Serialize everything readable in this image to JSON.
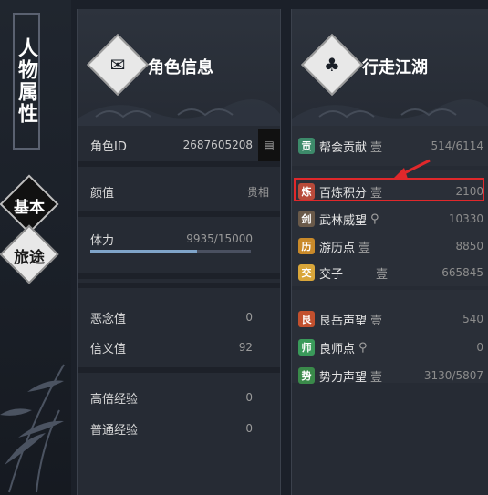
{
  "left_panel": {
    "title": "人物属性",
    "tabs": [
      {
        "label": "基本",
        "active": false
      },
      {
        "label": "旅途",
        "active": true
      }
    ]
  },
  "character_info": {
    "title": "角色信息",
    "role_id_label": "角色ID",
    "role_id_value": "2687605208",
    "appearance_label": "颜值",
    "appearance_value": "贵相",
    "stamina_label": "体力",
    "stamina_value": "9935/15000",
    "stamina_fraction": 0.662,
    "evil_label": "恶念值",
    "evil_value": "0",
    "faith_label": "信义值",
    "faith_value": "92",
    "multi_exp_label": "高倍经验",
    "multi_exp_value": "0",
    "normal_exp_label": "普通经验",
    "normal_exp_value": "0"
  },
  "jianghu": {
    "title": "行走江湖",
    "items": [
      {
        "icon": "贡",
        "label": "帮会贡献",
        "value": "514/6114",
        "icon_color": "#3d8a6a"
      },
      {
        "icon": "炼",
        "label": "百炼积分",
        "value": "2100",
        "icon_color": "#b84a3a"
      },
      {
        "icon": "剑",
        "label": "武林威望",
        "value": "10330",
        "icon_color": "#8a7a6a"
      },
      {
        "icon": "历",
        "label": "游历点",
        "value": "8850",
        "icon_color": "#c98a2a"
      },
      {
        "icon": "交",
        "label": "交子",
        "value": "665845",
        "icon_color": "#d9a63a"
      },
      {
        "icon": "艮",
        "label": "艮岳声望",
        "value": "540",
        "icon_color": "#c2502e"
      },
      {
        "icon": "师",
        "label": "良师点",
        "value": "0",
        "icon_color": "#3a9a5a"
      },
      {
        "icon": "势",
        "label": "势力声望",
        "value": "3130/5807",
        "icon_color": "#3a8a4a"
      }
    ]
  },
  "colors": {
    "highlight": "#e0282b",
    "stamina_bar": "#7fa4c9"
  }
}
